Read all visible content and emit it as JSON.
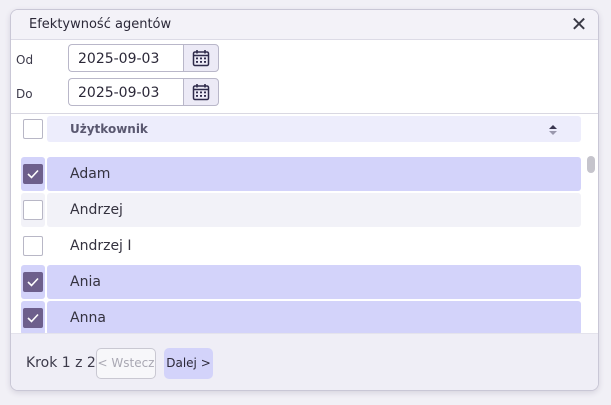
{
  "dialog": {
    "title": "Efektywność agentów",
    "close_glyph": "✕"
  },
  "filters": {
    "from_label": "Od",
    "from_value": "2025-09-03",
    "to_label": "Do",
    "to_value": "2025-09-03"
  },
  "table": {
    "column_header": "Użytkownik",
    "sort_glyph": "▲▼",
    "rows": [
      {
        "name": "Adam",
        "checked": true
      },
      {
        "name": "Andrzej",
        "checked": false
      },
      {
        "name": "Andrzej I",
        "checked": false
      },
      {
        "name": "Ania",
        "checked": true
      },
      {
        "name": "Anna",
        "checked": true
      }
    ]
  },
  "footer": {
    "step_text": "Krok 1 z 2",
    "back_label": "< Wstecz",
    "next_label": "Dalej >"
  },
  "colors": {
    "accent": "#6d5f8c",
    "selected_row": "#d3d3fa",
    "header_bg": "#ededfc"
  },
  "icons": {
    "close": "close-icon",
    "calendar": "calendar-icon",
    "check": "check-icon",
    "sort": "sort-icon"
  }
}
